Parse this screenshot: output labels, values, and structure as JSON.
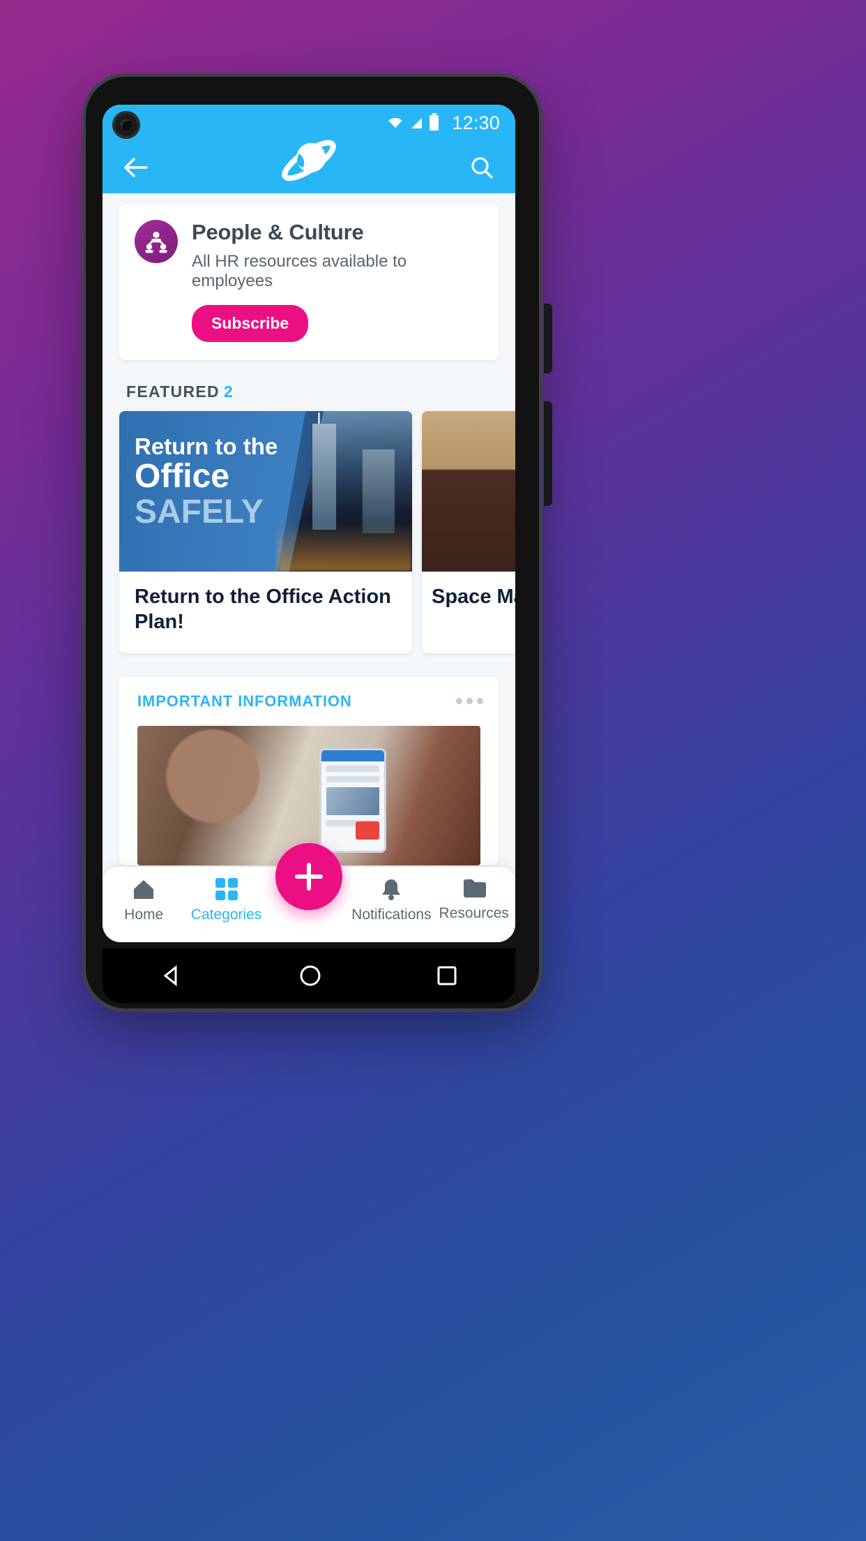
{
  "status_bar": {
    "time": "12:30",
    "icons": [
      "wifi-icon",
      "signal-icon",
      "battery-icon"
    ]
  },
  "app_bar": {
    "back_icon": "back-arrow-icon",
    "logo": "planet-logo-icon",
    "search_icon": "search-icon"
  },
  "subscribe_card": {
    "avatar_icon": "people-network-icon",
    "title": "People & Culture",
    "description": "All HR resources available to employees",
    "button_label": "Subscribe",
    "accent_color": "#ec0f84",
    "avatar_color": "#8c2287"
  },
  "featured": {
    "label": "FEATURED",
    "count": "2",
    "count_color": "#29b6f6",
    "cards": [
      {
        "banner_line1": "Return to the",
        "banner_line2": "Office",
        "banner_line3": "SAFELY",
        "title": "Return to the Office Action Plan!"
      },
      {
        "title": "Space Mana"
      }
    ]
  },
  "important_information": {
    "label": "IMPORTANT INFORMATION",
    "label_color": "#29b6f6",
    "overflow_icon": "more-horizontal-icon"
  },
  "bottom_nav": {
    "items": [
      {
        "label": "Home",
        "icon": "home-icon",
        "active": false
      },
      {
        "label": "Categories",
        "icon": "grid-icon",
        "active": true
      },
      {
        "label": "Notifications",
        "icon": "bell-icon",
        "active": false
      },
      {
        "label": "Resources",
        "icon": "folder-icon",
        "active": false
      }
    ],
    "fab_icon": "plus-icon",
    "fab_color": "#ec0f84",
    "active_color": "#29b6f6"
  },
  "android_nav": {
    "back_icon": "triangle-back-icon",
    "home_icon": "circle-home-icon",
    "recents_icon": "square-recents-icon"
  },
  "theme": {
    "header_color": "#29b6f6",
    "background_start": "#982a8e",
    "background_end": "#2a5ba8"
  }
}
